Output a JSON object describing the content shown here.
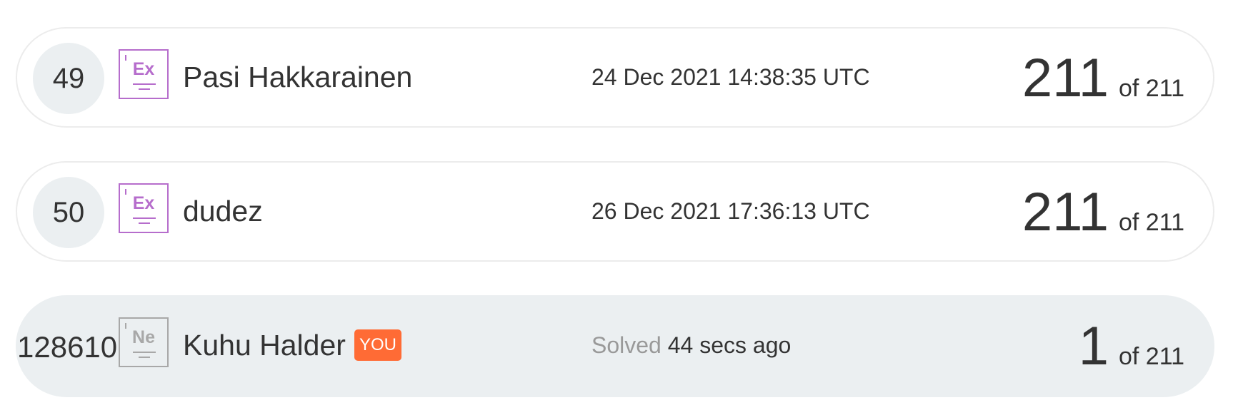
{
  "leaderboard": {
    "rows": [
      {
        "rank": "49",
        "level": "Ex",
        "name": "Pasi Hakkarainen",
        "date": "24 Dec 2021 14:38:35 UTC",
        "score": "211",
        "total": "of 211"
      },
      {
        "rank": "50",
        "level": "Ex",
        "name": "dudez",
        "date": "26 Dec 2021 17:36:13 UTC",
        "score": "211",
        "total": "of 211"
      },
      {
        "rank": "128610",
        "level": "Ne",
        "name": "Kuhu Halder",
        "badge": "YOU",
        "date_prefix": "Solved",
        "date": "44 secs ago",
        "score": "1",
        "total": "of 211"
      }
    ]
  },
  "colors": {
    "expert_badge": "#b66dcc",
    "newbie_badge": "#a8a8a8",
    "you_badge": "#ff6b35",
    "current_user_row": "#ebeff1",
    "rank_circle": "#ebeff1"
  },
  "icons": {
    "level_badge": "level-badge-icon"
  }
}
